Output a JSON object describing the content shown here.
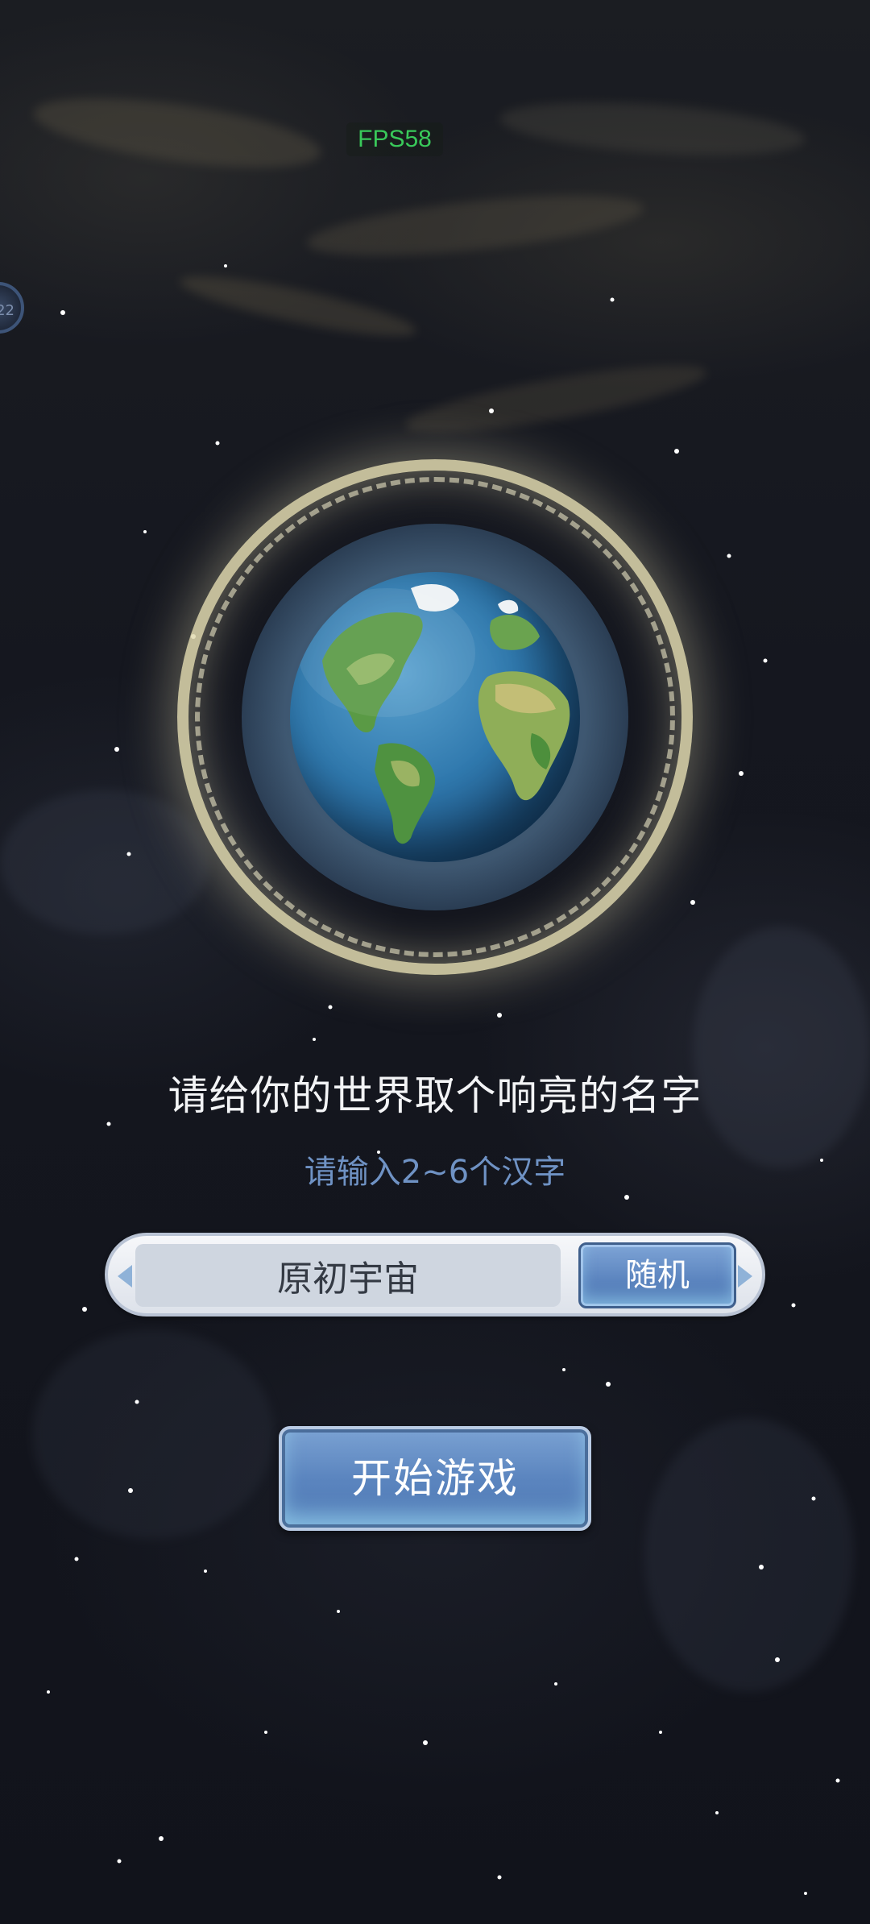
{
  "hud": {
    "fps_text": "FPS58",
    "side_badge_text": "22"
  },
  "prompt": {
    "title": "请给你的世界取个响亮的名字",
    "hint": "请输入2~6个汉字"
  },
  "name_bar": {
    "current_name": "原初宇宙",
    "random_label": "随机"
  },
  "start_button": {
    "label": "开始游戏"
  },
  "colors": {
    "fps": "#39c95a",
    "hint": "#6f92c4",
    "button_blue": "#5b85bf",
    "ring_gold": "#e2dab0"
  },
  "icons": {
    "globe": "earth-globe-icon",
    "left_arrow": "arrow-left-icon",
    "right_arrow": "arrow-right-icon"
  }
}
